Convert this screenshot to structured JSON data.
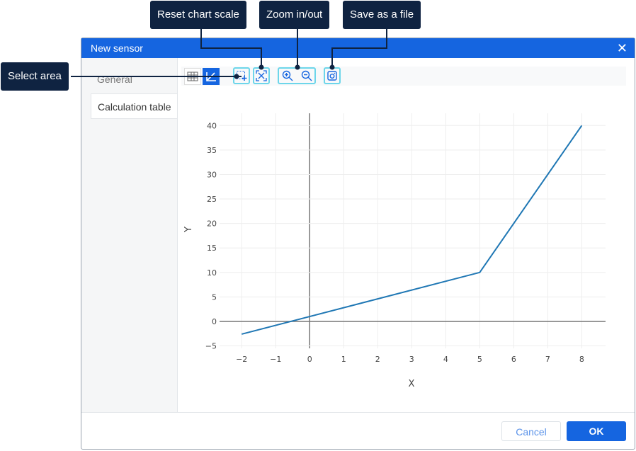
{
  "dialog": {
    "title": "New sensor",
    "close_icon": "close-icon"
  },
  "tabs": [
    {
      "label": "General"
    },
    {
      "label": "Calculation table",
      "active": true
    }
  ],
  "toolbar": {
    "table_view": "table-icon",
    "chart_view": "chart-icon",
    "select_area": "select-area-icon",
    "reset_scale": "reset-scale-icon",
    "zoom_in": "zoom-in-icon",
    "zoom_out": "zoom-out-icon",
    "save": "camera-icon"
  },
  "callouts": {
    "reset": "Reset chart scale",
    "zoom": "Zoom in/out",
    "save": "Save as a file",
    "select": "Select area"
  },
  "footer": {
    "cancel": "Cancel",
    "ok": "OK"
  },
  "colors": {
    "accent": "#1565e0",
    "line": "#1f77b4",
    "callout": "#0f2341",
    "highlight": "#6dd6ea"
  },
  "chart_data": {
    "type": "line",
    "xlabel": "X",
    "ylabel": "Y",
    "x": [
      -2,
      0,
      5,
      8
    ],
    "y": [
      -2.6,
      1,
      10,
      40
    ],
    "xlim": [
      -2.65,
      8.7
    ],
    "ylim": [
      -5.5,
      42.5
    ],
    "xticks": [
      "−2",
      "−1",
      "0",
      "1",
      "2",
      "3",
      "4",
      "5",
      "6",
      "7",
      "8"
    ],
    "yticks": [
      "−5",
      "0",
      "5",
      "10",
      "15",
      "20",
      "25",
      "30",
      "35",
      "40"
    ],
    "grid": true
  }
}
